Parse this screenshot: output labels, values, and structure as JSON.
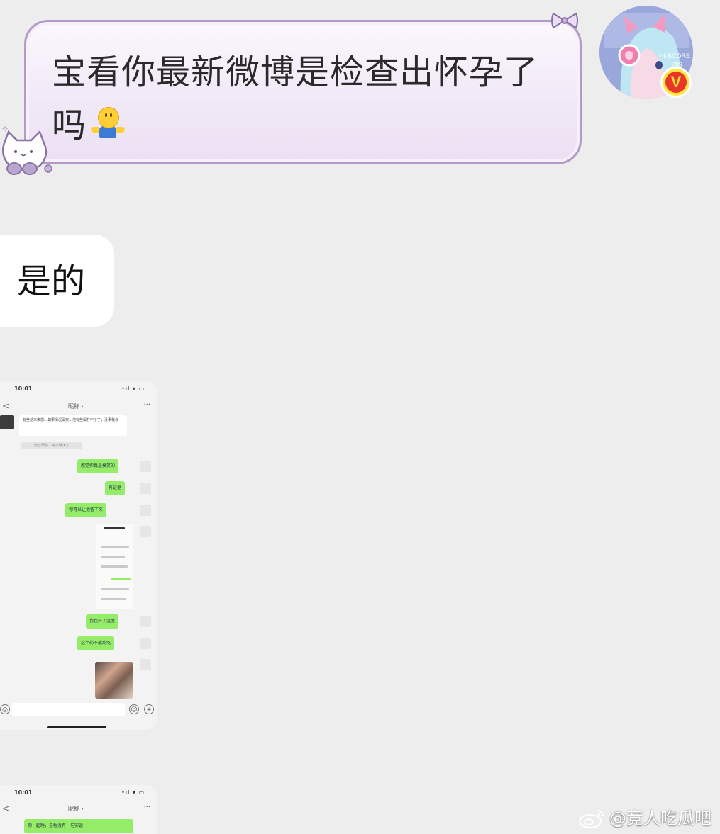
{
  "messages": {
    "sent": {
      "text": "宝看你最新微博是检查出怀孕了吗"
    },
    "received": {
      "text": "是的"
    }
  },
  "avatar": {
    "badge": "V",
    "decor_text": "HI-SCORE",
    "decor_num": "789"
  },
  "screenshot1": {
    "status_time": "10:01",
    "status_icons": "•ıl ▾ ▭",
    "nav_back": "<",
    "nav_title": "昵称 ›",
    "nav_more": "···",
    "incoming": "有些他本来想…如果情况属实…他有些属打不了了，没事我会",
    "system_note": "你已添加…可以聊天了",
    "green_msgs": [
      "感觉你真是搞笑的",
      "有证据",
      "你可以让他留下来",
      "我也开了温度",
      "这个药不能乱吃"
    ],
    "input_icons": {
      "voice": "◎",
      "emoji": "☺",
      "plus": "+"
    }
  },
  "screenshot2": {
    "status_time": "10:01",
    "nav_back": "<",
    "nav_title": "昵称 ›",
    "nav_more": "···",
    "green_msg": "你一起睡，全程没有一句实话"
  },
  "watermark": {
    "text": "@竞人吃瓜吧"
  },
  "colors": {
    "bubble_border": "#b59ac9",
    "wechat_green": "#95ec69",
    "background": "#ededed",
    "badge_red": "#e8372a",
    "badge_gold": "#ffe640"
  }
}
